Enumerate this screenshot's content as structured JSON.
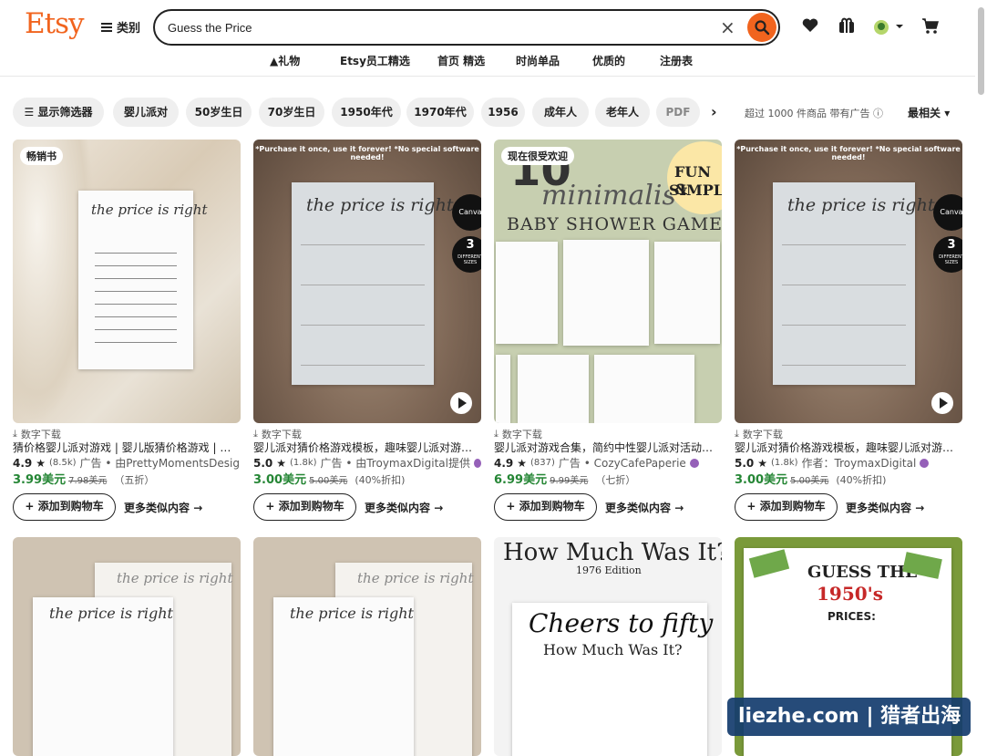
{
  "header": {
    "logo": "Etsy",
    "categories_label": "类别",
    "search_value": "Guess the Price"
  },
  "nav": [
    "礼物",
    "Etsy员工精选",
    "首页 精选",
    "时尚单品",
    "优质的",
    "注册表"
  ],
  "filters": {
    "show_filters": "显示筛选器",
    "chips": [
      "婴儿派对",
      "50岁生日",
      "70岁生日",
      "1950年代",
      "1970年代",
      "1956",
      "成年人",
      "老年人",
      "PDF"
    ],
    "result_count": "超过 1000 件商品 带有广告",
    "sort_label": "最相关"
  },
  "cards": [
    {
      "badge": "畅销书",
      "download": "数字下载",
      "title": "猜价格婴儿派对游戏 | 婴儿版猜价格游戏 | 猜价…",
      "rating": "4.9",
      "reviews": "(8.5k)",
      "seller": "广告 • 由PrettyMomentsDesign…",
      "price": "3.99美元",
      "old_price": "7.98美元",
      "discount": "（五折）",
      "add": "添加到购物车",
      "more": "更多类似内容"
    },
    {
      "badge": "",
      "download": "数字下载",
      "title": "婴儿派对猜价格游戏模板，趣味婴儿派对游戏，…",
      "rating": "5.0",
      "reviews": "(1.8k)",
      "seller": "广告 • 由TroymaxDigital提供",
      "price": "3.00美元",
      "old_price": "5.00美元",
      "discount": "(40%折扣)",
      "add": "添加到购物车",
      "more": "更多类似内容"
    },
    {
      "badge": "现在很受欢迎",
      "download": "数字下载",
      "title": "婴儿派对游戏合集，简约中性婴儿派对活动，可…",
      "rating": "4.9",
      "reviews": "(837)",
      "seller": "广告 • CozyCafePaperie",
      "price": "6.99美元",
      "old_price": "9.99美元",
      "discount": "（七折）",
      "add": "添加到购物车",
      "more": "更多类似内容"
    },
    {
      "badge": "",
      "download": "数字下载",
      "title": "婴儿派对猜价格游戏模板，趣味婴儿派对游戏，…",
      "rating": "5.0",
      "reviews": "(1.8k)",
      "seller": "作者：TroymaxDigital",
      "price": "3.00美元",
      "old_price": "5.00美元",
      "discount": "(40%折扣)",
      "add": "添加到购物车",
      "more": "更多类似内容"
    }
  ],
  "art": {
    "price_right": "the price is right",
    "canva": "Canva",
    "sizes_num": "3",
    "sizes_text": "DIFFERENT SIZES",
    "purchase_note": "*Purchase it once, use it forever! *No special software needed!",
    "ten": "10",
    "minimalist": "minimalist",
    "baby_shower_games": "BABY SHOWER GAMES",
    "fun": "FUN &",
    "simple": "SIMPL",
    "how_much": "How Much Was It?",
    "edition": "1976 Edition",
    "cheers": "Cheers to fifty",
    "guess": "GUESS THE",
    "year": "1950's",
    "prices": "PRICES:"
  },
  "watermark": "liezhe.com | 猎者出海",
  "colors": {
    "brand": "#f1641e",
    "price_green": "#258635",
    "verified": "#9560b8"
  }
}
